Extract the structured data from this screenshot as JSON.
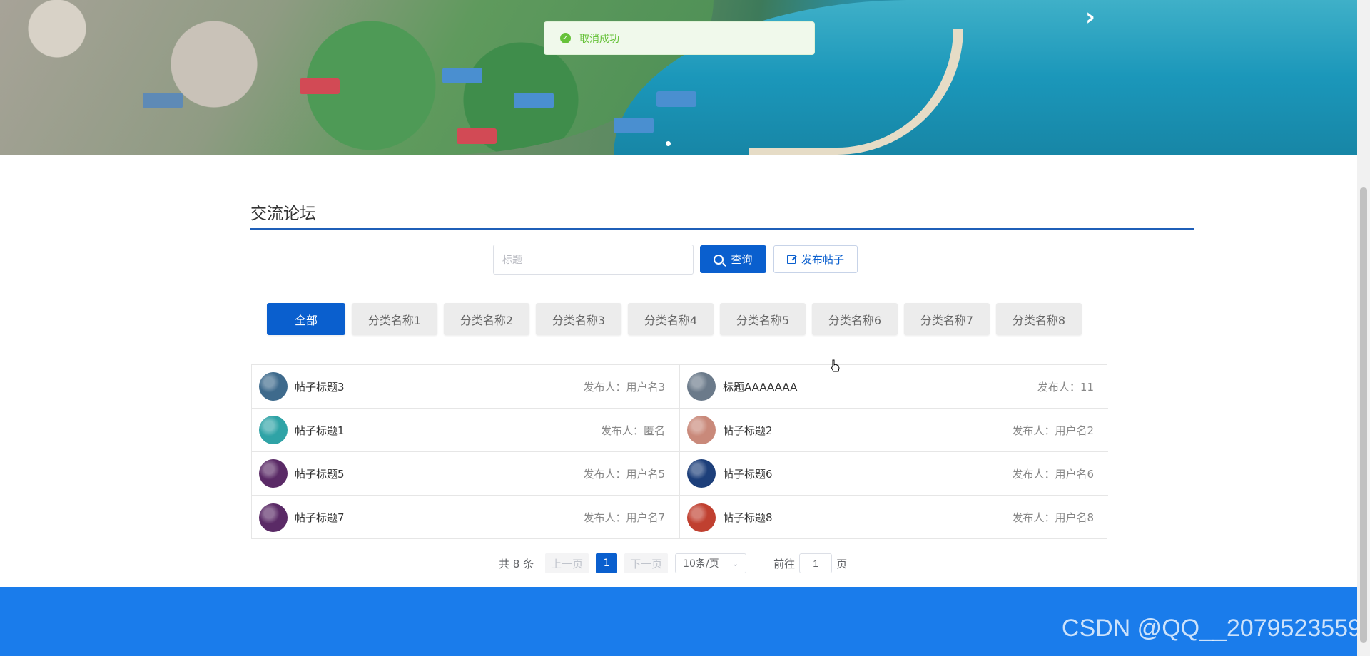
{
  "toast": {
    "message": "取消成功",
    "icon": "check-circle-icon"
  },
  "banner": {
    "next_icon": "chevron-right-icon"
  },
  "section": {
    "title": "交流论坛"
  },
  "search": {
    "placeholder": "标题",
    "value": ""
  },
  "buttons": {
    "query": "查询",
    "post": "发布帖子"
  },
  "categories": [
    {
      "label": "全部",
      "active": true
    },
    {
      "label": "分类名称1"
    },
    {
      "label": "分类名称2"
    },
    {
      "label": "分类名称3"
    },
    {
      "label": "分类名称4"
    },
    {
      "label": "分类名称5"
    },
    {
      "label": "分类名称6"
    },
    {
      "label": "分类名称7"
    },
    {
      "label": "分类名称8"
    }
  ],
  "posts": [
    {
      "title": "帖子标题3",
      "author": "发布人：用户名3",
      "avatar_color": "#3e6a8c"
    },
    {
      "title": "标题AAAAAAA",
      "author": "发布人：11",
      "avatar_color": "#6b7a8a"
    },
    {
      "title": "帖子标题1",
      "author": "发布人：匿名",
      "avatar_color": "#2fa3a6"
    },
    {
      "title": "帖子标题2",
      "author": "发布人：用户名2",
      "avatar_color": "#c9897a"
    },
    {
      "title": "帖子标题5",
      "author": "发布人：用户名5",
      "avatar_color": "#5a2a66"
    },
    {
      "title": "帖子标题6",
      "author": "发布人：用户名6",
      "avatar_color": "#1d3f7a"
    },
    {
      "title": "帖子标题7",
      "author": "发布人：用户名7",
      "avatar_color": "#5a2a66"
    },
    {
      "title": "帖子标题8",
      "author": "发布人：用户名8",
      "avatar_color": "#c04030"
    }
  ],
  "pagination": {
    "total": "共 8 条",
    "prev": "上一页",
    "current": "1",
    "next": "下一页",
    "page_size": "10条/页",
    "goto_label": "前往",
    "goto_value": "1",
    "page_suffix": "页"
  },
  "watermark": "CSDN @QQ__2079523559"
}
